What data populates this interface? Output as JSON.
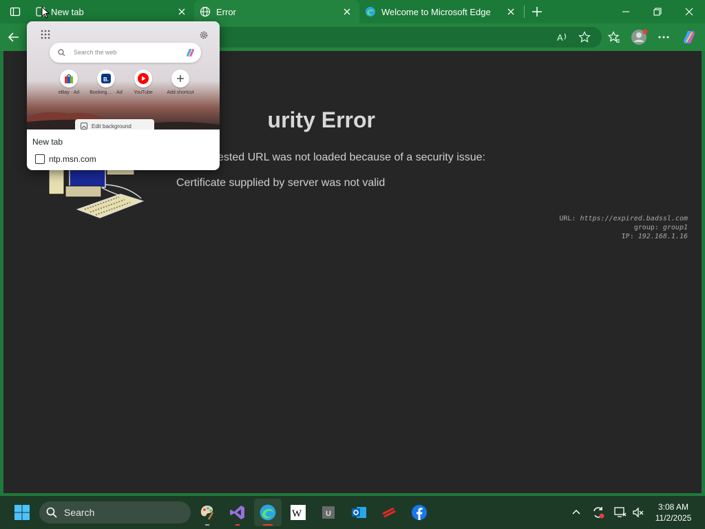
{
  "tabs": [
    {
      "title": "New tab",
      "active": false
    },
    {
      "title": "Error",
      "active": true
    },
    {
      "title": "Welcome to Microsoft Edge",
      "active": false
    }
  ],
  "preview": {
    "search_placeholder": "Search the web",
    "shortcuts": [
      {
        "label": "eBay",
        "badge": "Ad",
        "icon": "ebay-bag-icon"
      },
      {
        "label": "Booking....",
        "badge": "Ad",
        "icon": "booking-icon"
      },
      {
        "label": "YouTube",
        "badge": "",
        "icon": "youtube-icon"
      },
      {
        "label": "Add shortcut",
        "badge": "",
        "icon": "plus-icon"
      }
    ],
    "edit_background": "Edit background",
    "title": "New tab",
    "url": "ntp.msn.com"
  },
  "error_page": {
    "title": "Security Error",
    "title_visible": "urity Error",
    "description": "The requested URL was not loaded because of a security issue:",
    "description_visible": "ested URL was not loaded because of a security issue:",
    "detail": "Certificate supplied by server was not valid",
    "meta": {
      "url_label": "URL:",
      "url_value": "https://expired.badssl.com",
      "group_label": "group:",
      "group_value": "group1",
      "ip_label": "IP:",
      "ip_value": "192.168.1.16"
    }
  },
  "taskbar": {
    "search_label": "Search",
    "time": "3:08 AM",
    "date": "11/2/2025"
  },
  "colors": {
    "frame": "#1b7a38",
    "content_bg": "#262626",
    "taskbar": "#1c3a26"
  }
}
